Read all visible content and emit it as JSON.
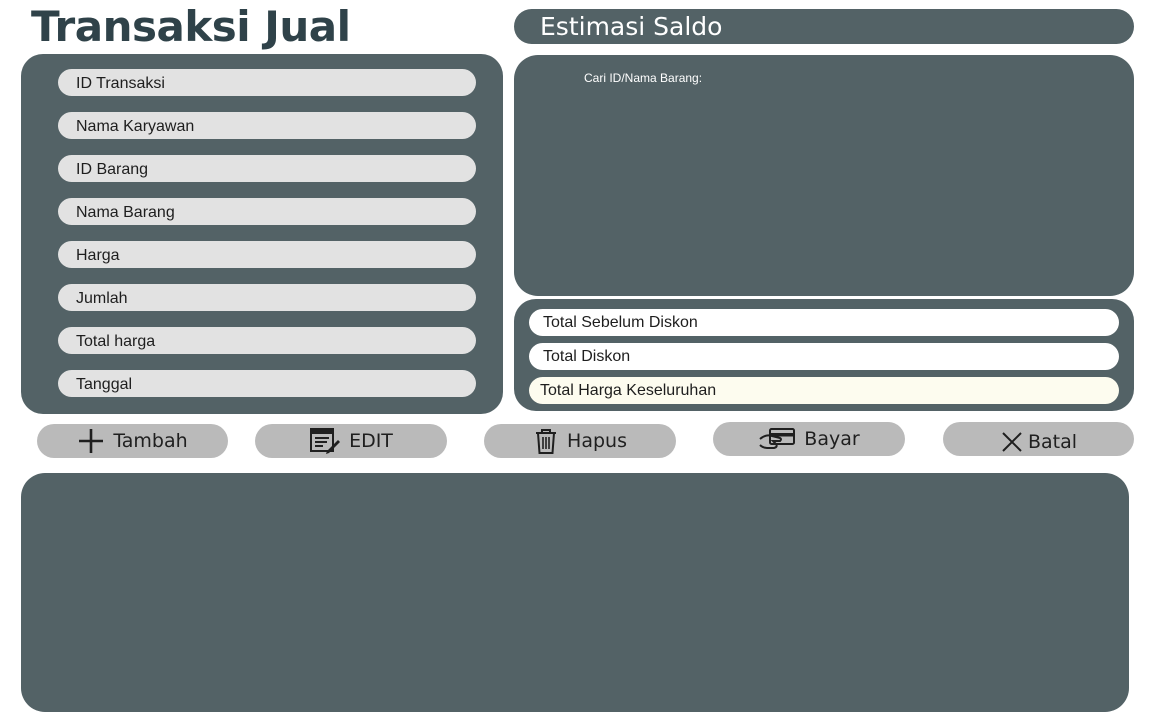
{
  "page": {
    "title": "Transaksi Jual"
  },
  "form": {
    "fields": [
      {
        "label": "ID Transaksi"
      },
      {
        "label": "Nama Karyawan"
      },
      {
        "label": "ID Barang"
      },
      {
        "label": "Nama Barang"
      },
      {
        "label": "Harga"
      },
      {
        "label": "Jumlah"
      },
      {
        "label": "Total harga"
      },
      {
        "label": "Tanggal"
      }
    ]
  },
  "saldo": {
    "title": "Estimasi Saldo"
  },
  "search": {
    "label": "Cari ID/Nama Barang:"
  },
  "totals": {
    "before_discount": "Total Sebelum Diskon",
    "discount": "Total Diskon",
    "grand_total": "Total Harga Keseluruhan"
  },
  "actions": {
    "add": {
      "label": "Tambah",
      "icon": "plus-icon"
    },
    "edit": {
      "label": "EDIT",
      "icon": "edit-icon"
    },
    "delete": {
      "label": "Hapus",
      "icon": "trash-icon"
    },
    "pay": {
      "label": "Bayar",
      "icon": "card-payment-icon"
    },
    "cancel": {
      "label": "Batal",
      "icon": "close-icon"
    }
  },
  "colors": {
    "panel": "#536266",
    "title": "#2f4249",
    "field": "#e2e2e2",
    "button": "#bababa",
    "grand_total_field": "#fdfcef"
  }
}
